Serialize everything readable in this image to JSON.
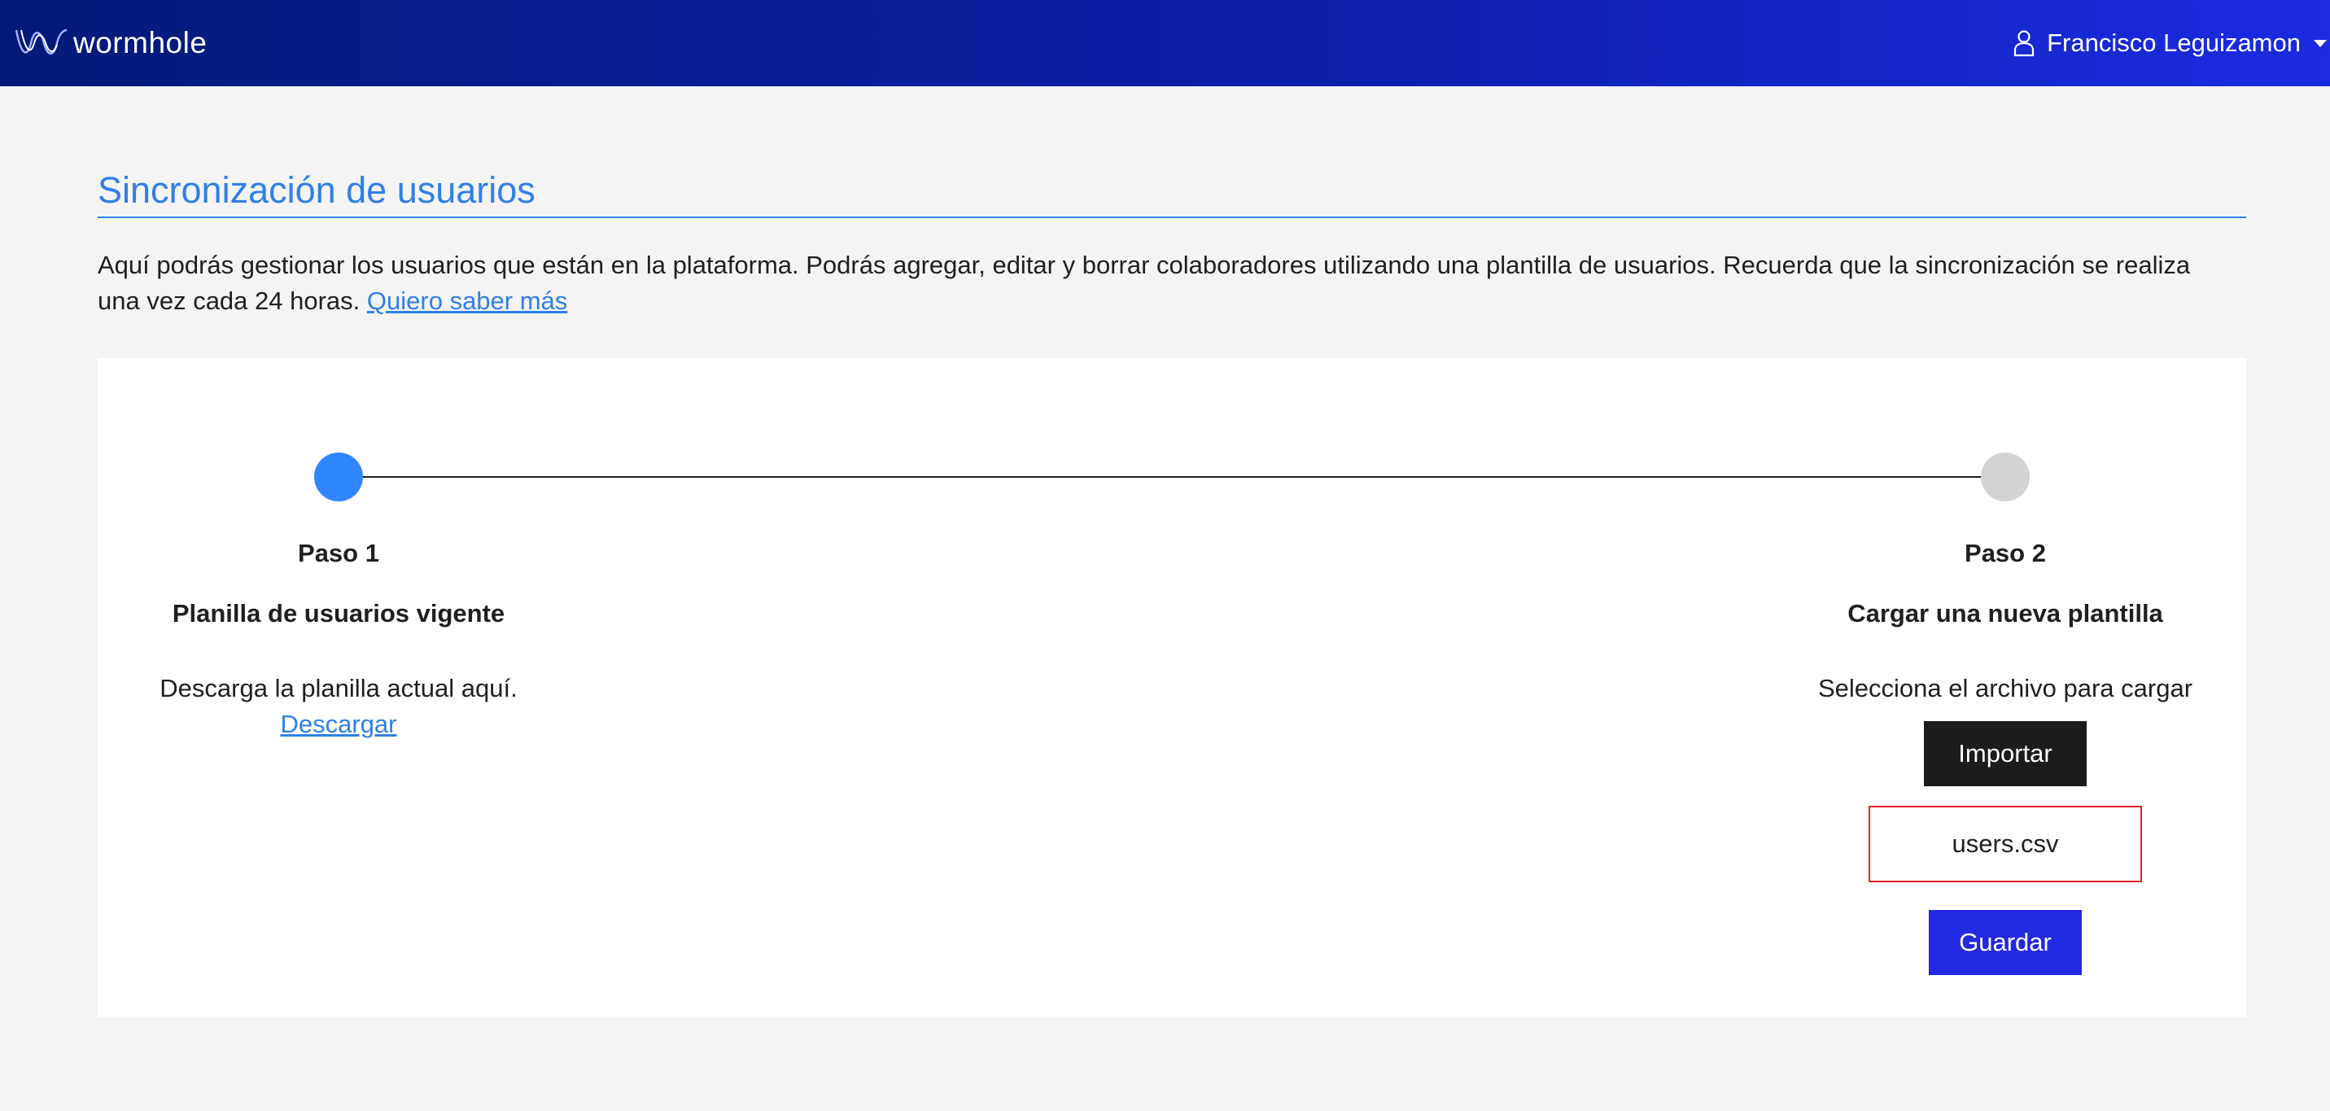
{
  "header": {
    "brand_name": "wormhole",
    "brand_icon": "wormhole-logo",
    "user_icon": "user-icon",
    "user_name": "Francisco Leguizamon",
    "colors": {
      "gradient_start": "#031a78",
      "gradient_end": "#1a2be0"
    }
  },
  "page": {
    "title": "Sincronización de usuarios",
    "intro_text": "Aquí podrás gestionar los usuarios que están en la plataforma. Podrás agregar, editar y borrar colaboradores utilizando una plantilla de usuarios. Recuerda que la sincronización se realiza una vez cada 24 horas.",
    "intro_link": "Quiero saber más",
    "accent_color": "#2f7fe8"
  },
  "stepper": {
    "steps": [
      {
        "number_label": "Paso 1",
        "title": "Planilla de usuarios vigente",
        "description": "Descarga la planilla actual aquí.",
        "link": "Descargar",
        "state": "active"
      },
      {
        "number_label": "Paso 2",
        "title": "Cargar una nueva plantilla",
        "description": "Selecciona el archivo para cargar",
        "import_button": "Importar",
        "selected_file": "users.csv",
        "save_button": "Guardar",
        "state": "inactive"
      }
    ],
    "colors": {
      "active": "#2f86ff",
      "inactive": "#d3d3d3",
      "save": "#2229e0",
      "file_border": "#e02424"
    }
  }
}
